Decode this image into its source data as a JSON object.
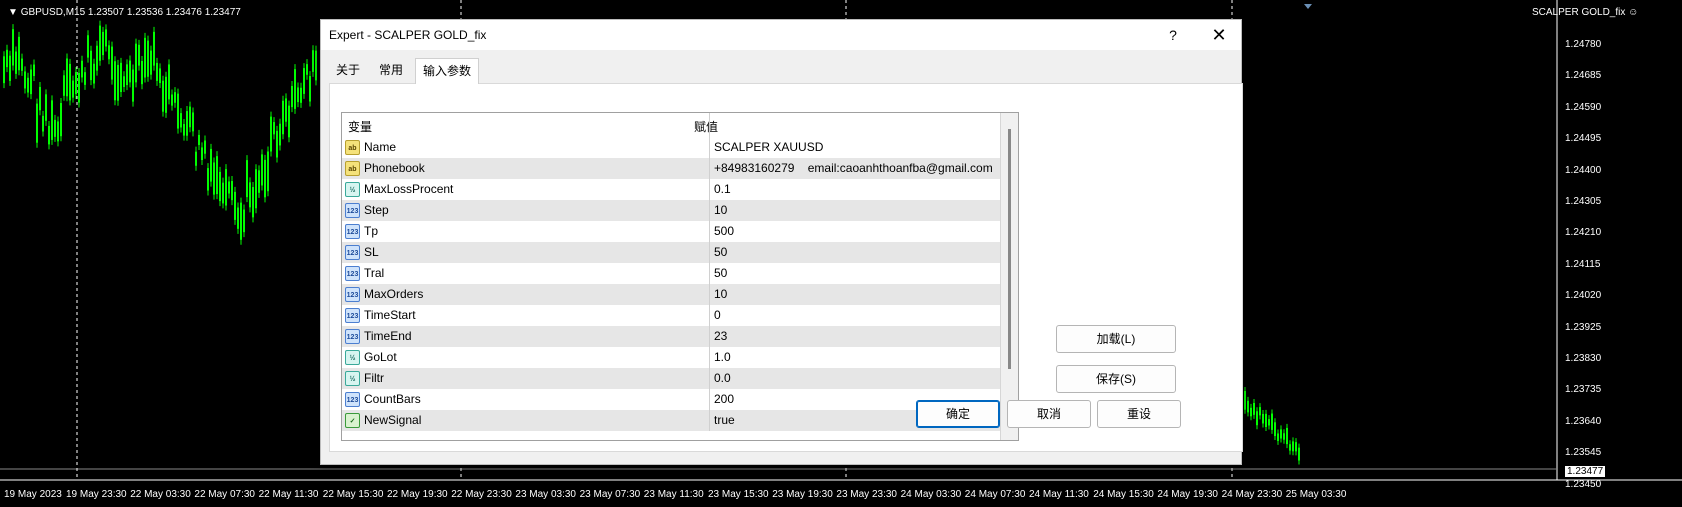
{
  "chart": {
    "symbol_line": "GBPUSD,M15  1.23507 1.23536 1.23476 1.23477",
    "expert_label": "SCALPER GOLD_fix",
    "price_levels": [
      "1.24780",
      "1.24685",
      "1.24590",
      "1.24495",
      "1.24400",
      "1.24305",
      "1.24210",
      "1.24115",
      "1.24020",
      "1.23925",
      "1.23830",
      "1.23735",
      "1.23640",
      "1.23545",
      "1.23450"
    ],
    "current_price": "1.23477",
    "time_labels": [
      "19 May 2023",
      "19 May 23:30",
      "22 May 03:30",
      "22 May 07:30",
      "22 May 11:30",
      "22 May 15:30",
      "22 May 19:30",
      "22 May 23:30",
      "23 May 03:30",
      "23 May 07:30",
      "23 May 11:30",
      "23 May 15:30",
      "23 May 19:30",
      "23 May 23:30",
      "24 May 03:30",
      "24 May 07:30",
      "24 May 11:30",
      "24 May 15:30",
      "24 May 19:30",
      "24 May 23:30",
      "25 May 03:30"
    ],
    "colors": {
      "background": "#000000",
      "candles": "#00ff00",
      "grid": "#ffffff"
    }
  },
  "dialog": {
    "title": "Expert - SCALPER GOLD_fix",
    "help_label": "?",
    "close_label": "✕",
    "tabs": [
      {
        "label": "关于",
        "active": false
      },
      {
        "label": "常用",
        "active": false
      },
      {
        "label": "输入参数",
        "active": true
      }
    ],
    "grid": {
      "header_variable": "变量",
      "header_value": "赋值",
      "rows": [
        {
          "name": "Name",
          "value": "SCALPER XAUUSD",
          "icon": "ab"
        },
        {
          "name": "Phonebook",
          "value": "+84983160279    email:caoanhthoanfba@gmail.com",
          "icon": "ab"
        },
        {
          "name": "MaxLossProcent",
          "value": "0.1",
          "icon": "dbl"
        },
        {
          "name": "Step",
          "value": "10",
          "icon": "num"
        },
        {
          "name": "Tp",
          "value": "500",
          "icon": "num"
        },
        {
          "name": "SL",
          "value": "50",
          "icon": "num"
        },
        {
          "name": "Tral",
          "value": "50",
          "icon": "num"
        },
        {
          "name": "MaxOrders",
          "value": "10",
          "icon": "num"
        },
        {
          "name": "TimeStart",
          "value": "0",
          "icon": "num"
        },
        {
          "name": "TimeEnd",
          "value": "23",
          "icon": "num"
        },
        {
          "name": "GoLot",
          "value": "1.0",
          "icon": "dbl"
        },
        {
          "name": "Filtr",
          "value": "0.0",
          "icon": "dbl"
        },
        {
          "name": "CountBars",
          "value": "200",
          "icon": "num"
        },
        {
          "name": "NewSignal",
          "value": "true",
          "icon": "bool"
        }
      ]
    },
    "buttons": {
      "load": "加载(L)",
      "save": "保存(S)",
      "ok": "确定",
      "cancel": "取消",
      "reset": "重设"
    }
  }
}
